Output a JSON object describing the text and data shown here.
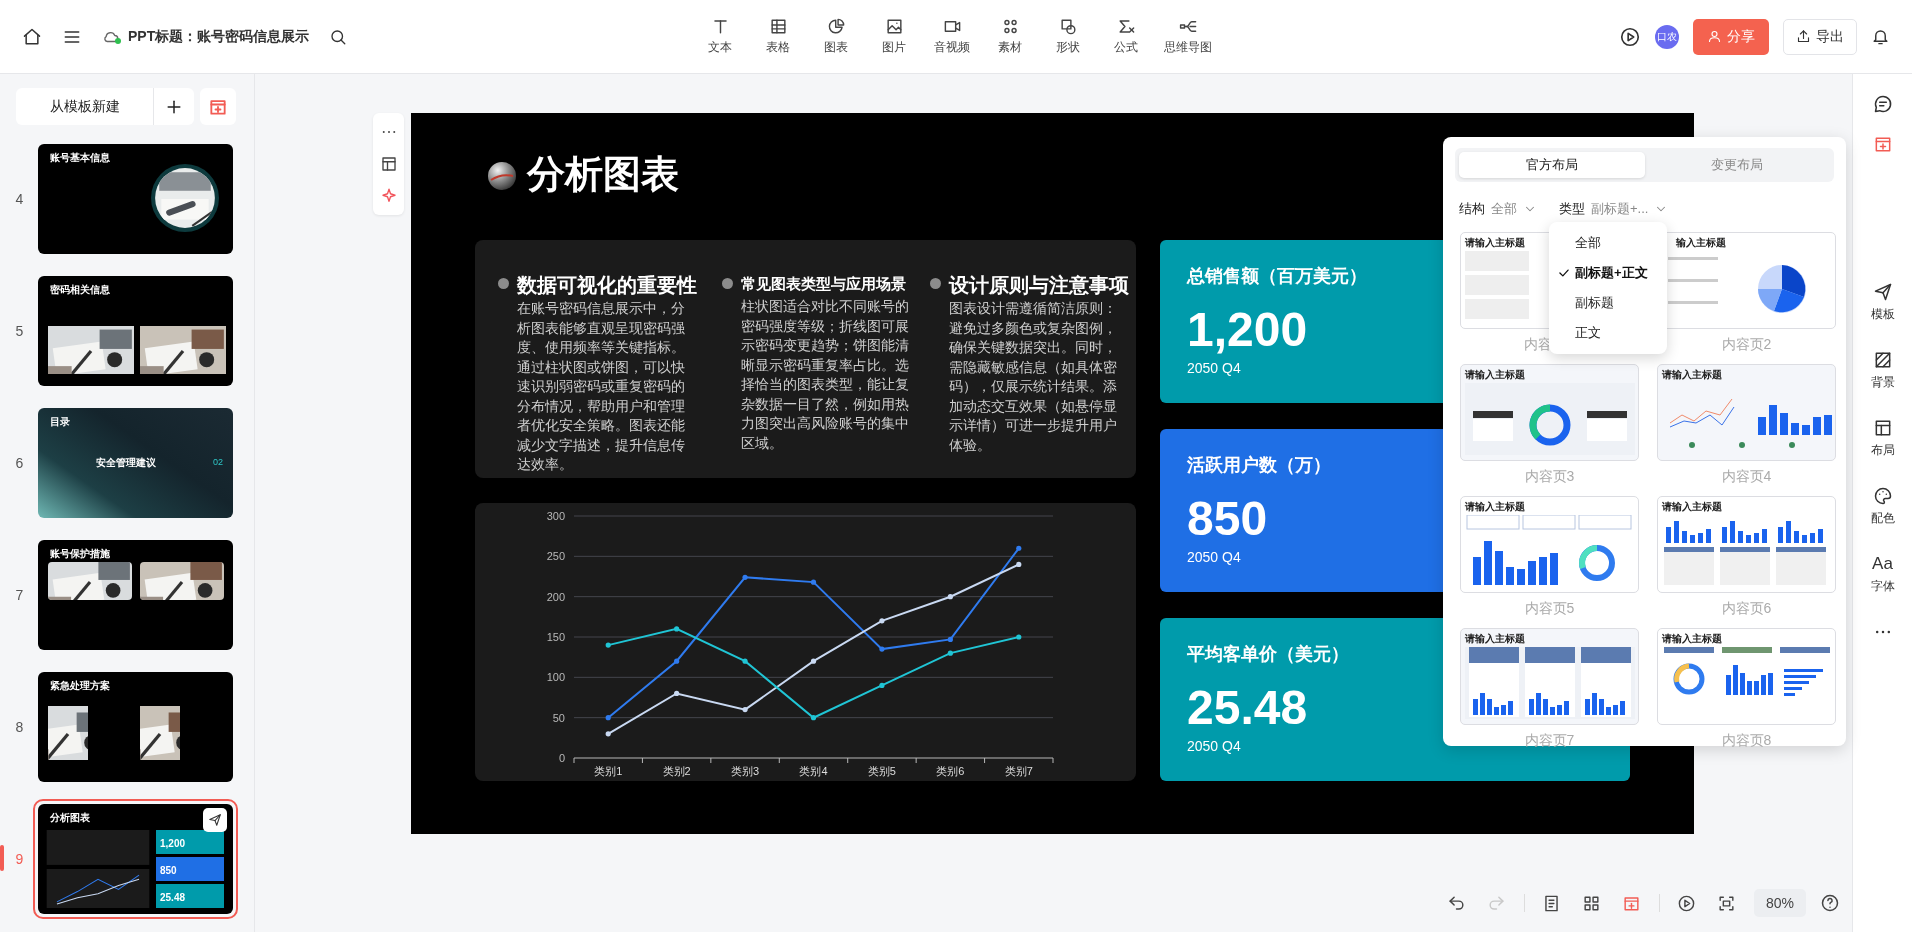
{
  "topbar": {
    "title": "PPT标题：账号密码信息展示",
    "tools": [
      "文本",
      "表格",
      "图表",
      "图片",
      "音视频",
      "素材",
      "形状",
      "公式",
      "思维导图"
    ],
    "avatar": "口农",
    "share": "分享",
    "export": "导出"
  },
  "slides_panel": {
    "new_from_template": "从模板新建",
    "slides": [
      {
        "number": "4",
        "title": "账号基本信息",
        "kind": "circle-photo",
        "selected": false
      },
      {
        "number": "5",
        "title": "密码相关信息",
        "kind": "two-photos-low",
        "selected": false
      },
      {
        "number": "6",
        "title": "目录",
        "kind": "toc",
        "entries": [
          "安全管理建议",
          "02"
        ],
        "selected": false
      },
      {
        "number": "7",
        "title": "账号保护措施",
        "kind": "two-photos-high",
        "selected": false
      },
      {
        "number": "8",
        "title": "紧急处理方案",
        "kind": "two-photos-narrow",
        "selected": false
      },
      {
        "number": "9",
        "title": "分析图表",
        "kind": "dashboard",
        "figures": [
          "1,200",
          "850",
          "25.48"
        ],
        "selected": true
      }
    ]
  },
  "slide": {
    "title": "分析图表",
    "sections": [
      {
        "heading": "数据可视化的重要性",
        "prominent": true,
        "body": "在账号密码信息展示中，分析图表能够直观呈现密码强度、使用频率等关键指标。通过柱状图或饼图，可以快速识别弱密码或重复密码的分布情况，帮助用户和管理者优化安全策略。图表还能减少文字描述，提升信息传达效率。"
      },
      {
        "heading": "常见图表类型与应用场景",
        "prominent": false,
        "body": "柱状图适合对比不同账号的密码强度等级；折线图可展示密码变更趋势；饼图能清晰显示密码重复率占比。选择恰当的图表类型，能让复杂数据一目了然，例如用热力图突出高风险账号的集中区域。"
      },
      {
        "heading": "设计原则与注意事项",
        "prominent": true,
        "body": "图表设计需遵循简洁原则：避免过多颜色或复杂图例，确保关键数据突出。同时，需隐藏敏感信息（如具体密码），仅展示统计结果。添加动态交互效果（如悬停显示详情）可进一步提升用户体验。"
      }
    ],
    "chart_data": {
      "type": "line",
      "categories": [
        "类别1",
        "类别2",
        "类别3",
        "类别4",
        "类别5",
        "类别6",
        "类别7"
      ],
      "series": [
        {
          "color": "#2f7bef",
          "values": [
            50,
            120,
            224,
            218,
            135,
            147,
            260
          ]
        },
        {
          "color": "#c9d9f2",
          "values": [
            30,
            80,
            60,
            120,
            170,
            200,
            240
          ]
        },
        {
          "color": "#20c5d5",
          "values": [
            140,
            160,
            120,
            50,
            90,
            130,
            150
          ]
        }
      ],
      "ylim": [
        0,
        300
      ],
      "yticks": [
        0,
        50,
        100,
        150,
        200,
        250,
        300
      ],
      "grid": true
    },
    "kpis": [
      {
        "title": "总销售额（百万美元）",
        "value": "1,200",
        "period": "2050 Q4",
        "color": "#009bab"
      },
      {
        "title": "活跃用户数（万）",
        "value": "850",
        "period": "2050 Q4",
        "color": "#1f6fe5"
      },
      {
        "title": "平均客单价（美元）",
        "value": "25.48",
        "period": "2050 Q4",
        "color": "#009bab"
      }
    ]
  },
  "layout_panel": {
    "tabs": [
      {
        "label": "官方布局",
        "selected": true
      },
      {
        "label": "变更布局",
        "selected": false
      }
    ],
    "filters": [
      {
        "label": "结构",
        "value": "全部"
      },
      {
        "label": "类型",
        "value": "副标题+..."
      }
    ],
    "menu": [
      {
        "label": "全部",
        "selected": false
      },
      {
        "label": "副标题+正文",
        "selected": true
      },
      {
        "label": "副标题",
        "selected": false
      },
      {
        "label": "正文",
        "selected": false
      }
    ],
    "layouts": [
      {
        "heading": "请输入主标题",
        "label": "内容",
        "kind": "text-boxes"
      },
      {
        "heading": "输入主标题",
        "label": "内容页2",
        "kind": "pie"
      },
      {
        "heading": "请输入主标题",
        "label": "内容页3",
        "kind": "donut-table"
      },
      {
        "heading": "请输入主标题",
        "label": "内容页4",
        "kind": "line-bar"
      },
      {
        "heading": "请输入主标题",
        "label": "内容页5",
        "kind": "bar-donut"
      },
      {
        "heading": "请输入主标题",
        "label": "内容页6",
        "kind": "bars-3"
      },
      {
        "heading": "请输入主标题",
        "label": "内容页7",
        "kind": "bars-cards"
      },
      {
        "heading": "请输入主标题",
        "label": "内容页8",
        "kind": "mixed"
      }
    ]
  },
  "right_sidebar": {
    "top": [
      {
        "selected": false
      },
      {
        "selected": true
      }
    ],
    "items": [
      "模板",
      "背景",
      "布局",
      "配色",
      "字体"
    ],
    "font_glyph": "Aa"
  },
  "bottom_bar": {
    "tools": [
      {
        "disabled": false,
        "selected": false
      },
      {
        "disabled": true,
        "selected": false
      },
      {
        "disabled": false,
        "selected": false
      },
      {
        "disabled": false,
        "selected": false
      },
      {
        "disabled": false,
        "selected": true
      },
      {
        "disabled": false,
        "selected": false
      },
      {
        "disabled": false,
        "selected": false
      }
    ],
    "zoom": "80%"
  }
}
